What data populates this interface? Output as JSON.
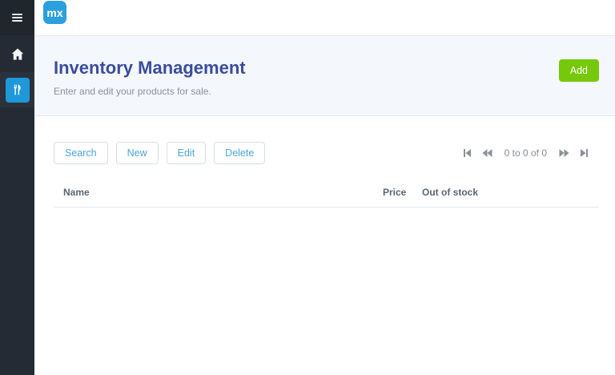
{
  "app": {
    "logo_text": "mx"
  },
  "sidebar": {
    "menu_icon": "hamburger-icon",
    "items": [
      {
        "icon": "home-icon",
        "active": false
      },
      {
        "icon": "cutlery-icon",
        "active": true
      }
    ]
  },
  "header": {
    "title": "Inventory Management",
    "subtitle": "Enter and edit your products for sale.",
    "add_button_label": "Add"
  },
  "toolbar": {
    "buttons": [
      {
        "label": "Search"
      },
      {
        "label": "New"
      },
      {
        "label": "Edit"
      },
      {
        "label": "Delete"
      }
    ]
  },
  "pagination": {
    "status": "0 to 0 of 0",
    "icons": [
      "first-page-icon",
      "previous-page-icon",
      "next-page-icon",
      "last-page-icon"
    ]
  },
  "table": {
    "columns": [
      {
        "label": "Name"
      },
      {
        "label": "Price"
      },
      {
        "label": "Out of stock"
      }
    ],
    "rows": []
  },
  "colors": {
    "top_line_blue": "#2da2e0",
    "logo_blue": "#2ba0dc",
    "active_tile_blue": "#1e98d8",
    "sidebar_dark": "#252b35",
    "header_panel_bg": "#f4f7fb",
    "title_blue": "#3a4d9b",
    "add_green": "#76c90a",
    "toolbar_text_blue": "#4ba4db",
    "pagination_gray": "#878e96"
  }
}
